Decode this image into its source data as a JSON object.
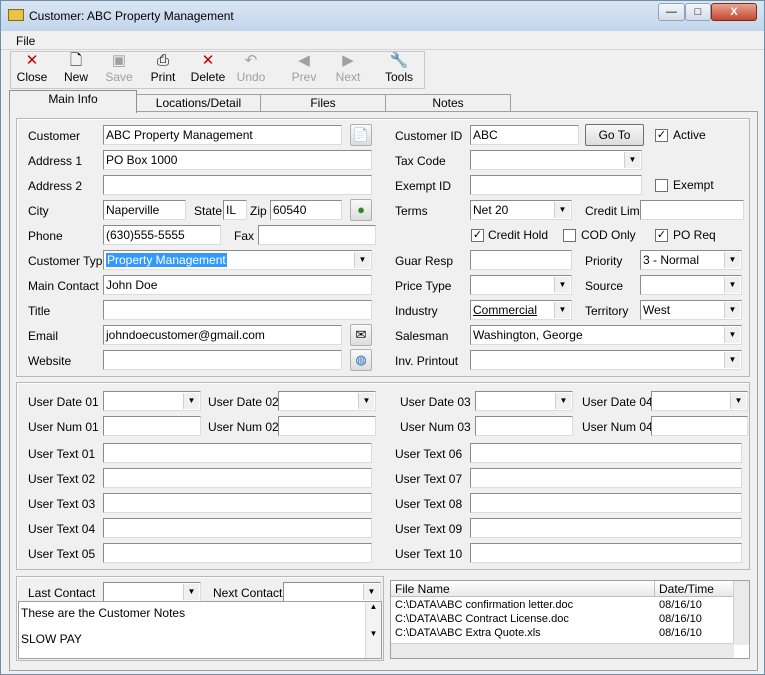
{
  "window": {
    "title": "Customer: ABC Property Management",
    "min": "—",
    "max": "□",
    "close": "X"
  },
  "menu": {
    "file": "File"
  },
  "toolbar": {
    "close": "Close",
    "new": "New",
    "save": "Save",
    "print": "Print",
    "delete": "Delete",
    "undo": "Undo",
    "prev": "Prev",
    "next": "Next",
    "tools": "Tools"
  },
  "tabs": [
    "Main Info",
    "Locations/Detail",
    "Files",
    "Notes"
  ],
  "left": {
    "customer_label": "Customer",
    "customer_value": "ABC Property Management",
    "address1_label": "Address 1",
    "address1_value": "PO Box 1000",
    "address2_label": "Address 2",
    "address2_value": "",
    "city_label": "City",
    "city_value": "Naperville",
    "state_label": "State",
    "state_value": "IL",
    "zip_label": "Zip",
    "zip_value": "60540",
    "phone_label": "Phone",
    "phone_value": "(630)555-5555",
    "fax_label": "Fax",
    "fax_value": "",
    "ctype_label": "Customer Type",
    "ctype_value": "Property Management",
    "contact_label": "Main Contact",
    "contact_value": "John Doe",
    "title_label": "Title",
    "title_value": "",
    "email_label": "Email",
    "email_value": "johndoecustomer@gmail.com",
    "website_label": "Website",
    "website_value": ""
  },
  "right": {
    "custid_label": "Customer ID",
    "custid_value": "ABC",
    "goto": "Go To",
    "active_label": "Active",
    "taxcode_label": "Tax Code",
    "taxcode_value": "",
    "exemptid_label": "Exempt ID",
    "exemptid_value": "",
    "exempt_label": "Exempt",
    "terms_label": "Terms",
    "terms_value": "Net 20",
    "creditlimit_label": "Credit Limit",
    "creditlimit_value": "",
    "credithold_label": "Credit Hold",
    "codonly_label": "COD Only",
    "poreq_label": "PO Req",
    "guarresp_label": "Guar Resp",
    "guarresp_value": "",
    "priority_label": "Priority",
    "priority_value": "3 - Normal",
    "pricetype_label": "Price Type",
    "pricetype_value": "",
    "source_label": "Source",
    "source_value": "",
    "industry_label": "Industry",
    "industry_value": "Commercial",
    "territory_label": "Territory",
    "territory_value": "West",
    "salesman_label": "Salesman",
    "salesman_value": "Washington, George",
    "invprintout_label": "Inv. Printout",
    "invprintout_value": ""
  },
  "user": {
    "date01": "User Date 01",
    "date02": "User Date 02",
    "date03": "User Date 03",
    "date04": "User Date 04",
    "num01": "User Num 01",
    "num02": "User Num 02",
    "num03": "User Num 03",
    "num04": "User Num 04",
    "text01": "User Text 01",
    "text02": "User Text 02",
    "text03": "User Text 03",
    "text04": "User Text 04",
    "text05": "User Text 05",
    "text06": "User Text 06",
    "text07": "User Text 07",
    "text08": "User Text 08",
    "text09": "User Text 09",
    "text10": "User Text 10"
  },
  "bottom": {
    "last_contact": "Last Contact",
    "next_contact": "Next Contact",
    "notes_line1": "These are the Customer Notes",
    "notes_line2": "SLOW PAY",
    "file_name_header": "File Name",
    "date_header": "Date/Time",
    "files": [
      {
        "name": "C:\\DATA\\ABC confirmation letter.doc",
        "date": "08/16/10"
      },
      {
        "name": "C:\\DATA\\ABC Contract License.doc",
        "date": "08/16/10"
      },
      {
        "name": "C:\\DATA\\ABC Extra Quote.xls",
        "date": "08/16/10"
      }
    ]
  }
}
